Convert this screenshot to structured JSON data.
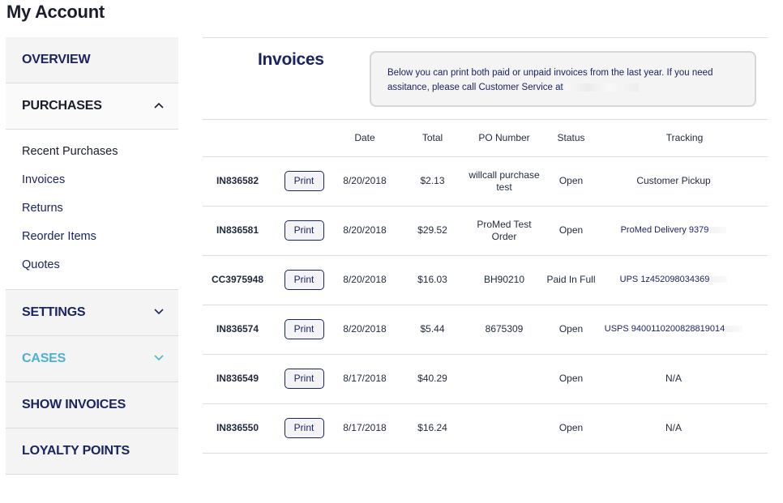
{
  "page": {
    "title": "My Account"
  },
  "sidebar": {
    "sections": [
      {
        "label": "OVERVIEW",
        "chevron": null
      },
      {
        "label": "PURCHASES",
        "chevron": "chevron-up-icon",
        "expanded": true
      },
      {
        "label": "SETTINGS",
        "chevron": "chevron-down-icon"
      },
      {
        "label": "CASES",
        "chevron": "chevron-down-icon"
      },
      {
        "label": "SHOW INVOICES",
        "chevron": null
      },
      {
        "label": "LOYALTY POINTS",
        "chevron": null
      }
    ],
    "purchases_items": [
      {
        "label": "Recent Purchases"
      },
      {
        "label": "Invoices",
        "active": true
      },
      {
        "label": "Returns"
      },
      {
        "label": "Reorder Items"
      },
      {
        "label": "Quotes"
      }
    ],
    "colors": {
      "primary": "#1b2463",
      "cases": "#4bb1d6",
      "section_bg": "#f4f4f4"
    }
  },
  "main": {
    "title": "Invoices",
    "info_text": "Below you can print both paid or unpaid invoices from the last year. If you need assitance, please call Customer Service at",
    "table": {
      "headers": [
        "",
        "",
        "Date",
        "Total",
        "PO Number",
        "Status",
        "Tracking"
      ],
      "print_label": "Print",
      "rows": [
        {
          "number": "IN836582",
          "date": "8/20/2018",
          "total": "$2.13",
          "po": "willcall purchase test",
          "status": "Open",
          "tracking": "Customer Pickup",
          "tracking_link": false
        },
        {
          "number": "IN836581",
          "date": "8/20/2018",
          "total": "$29.52",
          "po": "ProMed Test Order",
          "status": "Open",
          "tracking": "ProMed Delivery 9379",
          "tracking_link": true
        },
        {
          "number": "CC3975948",
          "date": "8/20/2018",
          "total": "$16.03",
          "po": "BH90210",
          "status": "Paid In Full",
          "tracking": "UPS 1z452098034369",
          "tracking_link": true
        },
        {
          "number": "IN836574",
          "date": "8/20/2018",
          "total": "$5.44",
          "po": "8675309",
          "status": "Open",
          "tracking": "USPS 9400110200828819014",
          "tracking_link": true
        },
        {
          "number": "IN836549",
          "date": "8/17/2018",
          "total": "$40.29",
          "po": "",
          "status": "Open",
          "tracking": "N/A",
          "tracking_link": false
        },
        {
          "number": "IN836550",
          "date": "8/17/2018",
          "total": "$16.24",
          "po": "",
          "status": "Open",
          "tracking": "N/A",
          "tracking_link": false
        }
      ]
    }
  }
}
